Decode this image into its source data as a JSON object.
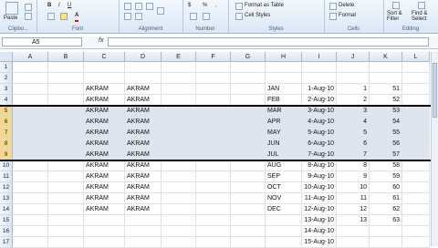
{
  "ribbon": {
    "clipboard": {
      "label": "Clipbo...",
      "paste": "Paste"
    },
    "font": {
      "label": "Font",
      "bold": "B",
      "italic": "I",
      "underline": "U",
      "font_color": "A"
    },
    "alignment": {
      "label": "Alignment"
    },
    "number": {
      "label": "Number",
      "currency": "$",
      "percent": "%",
      "comma": ","
    },
    "styles": {
      "label": "Styles",
      "format_as_table": "Format as Table",
      "cell_styles": "Cell Styles"
    },
    "cells": {
      "label": "Cells",
      "delete": "Delete",
      "format": "Format"
    },
    "editing": {
      "label": "Editing",
      "sort_filter": "Sort & Filter",
      "find_select": "Find & Select"
    }
  },
  "formula_bar": {
    "name_box": "A5",
    "fx": "fx",
    "value": ""
  },
  "columns": [
    "A",
    "B",
    "C",
    "D",
    "E",
    "F",
    "G",
    "H",
    "I",
    "J",
    "K",
    "L"
  ],
  "rows": [
    {
      "n": "1",
      "c": "",
      "d": "",
      "h": "",
      "i": "",
      "j": "",
      "k": "",
      "sel": false
    },
    {
      "n": "2",
      "c": "",
      "d": "",
      "h": "",
      "i": "",
      "j": "",
      "k": "",
      "sel": false
    },
    {
      "n": "3",
      "c": "AKRAM",
      "d": "AKRAM",
      "h": "JAN",
      "i": "1-Aug-10",
      "j": "1",
      "k": "51",
      "sel": false
    },
    {
      "n": "4",
      "c": "AKRAM",
      "d": "AKRAM",
      "h": "FEB",
      "i": "2-Aug-10",
      "j": "2",
      "k": "52",
      "sel": false
    },
    {
      "n": "5",
      "c": "AKRAM",
      "d": "AKRAM",
      "h": "MAR",
      "i": "3-Aug-10",
      "j": "3",
      "k": "53",
      "sel": true
    },
    {
      "n": "6",
      "c": "AKRAM",
      "d": "AKRAM",
      "h": "APR",
      "i": "4-Aug-10",
      "j": "4",
      "k": "54",
      "sel": true
    },
    {
      "n": "7",
      "c": "AKRAM",
      "d": "AKRAM",
      "h": "MAY",
      "i": "5-Aug-10",
      "j": "5",
      "k": "55",
      "sel": true
    },
    {
      "n": "8",
      "c": "AKRAM",
      "d": "AKRAM",
      "h": "JUN",
      "i": "6-Aug-10",
      "j": "6",
      "k": "56",
      "sel": true
    },
    {
      "n": "9",
      "c": "AKRAM",
      "d": "AKRAM",
      "h": "JUL",
      "i": "7-Aug-10",
      "j": "7",
      "k": "57",
      "sel": true
    },
    {
      "n": "10",
      "c": "AKRAM",
      "d": "AKRAM",
      "h": "AUG",
      "i": "8-Aug-10",
      "j": "8",
      "k": "58",
      "sel": false
    },
    {
      "n": "11",
      "c": "AKRAM",
      "d": "AKRAM",
      "h": "SEP",
      "i": "9-Aug-10",
      "j": "9",
      "k": "59",
      "sel": false
    },
    {
      "n": "12",
      "c": "AKRAM",
      "d": "AKRAM",
      "h": "OCT",
      "i": "10-Aug-10",
      "j": "10",
      "k": "60",
      "sel": false
    },
    {
      "n": "13",
      "c": "AKRAM",
      "d": "AKRAM",
      "h": "NOV",
      "i": "11-Aug-10",
      "j": "11",
      "k": "61",
      "sel": false
    },
    {
      "n": "14",
      "c": "AKRAM",
      "d": "AKRAM",
      "h": "DEC",
      "i": "12-Aug-10",
      "j": "12",
      "k": "62",
      "sel": false
    },
    {
      "n": "15",
      "c": "",
      "d": "",
      "h": "",
      "i": "13-Aug-10",
      "j": "13",
      "k": "63",
      "sel": false
    },
    {
      "n": "16",
      "c": "",
      "d": "",
      "h": "",
      "i": "14-Aug-10",
      "j": "",
      "k": "",
      "sel": false
    },
    {
      "n": "17",
      "c": "",
      "d": "",
      "h": "",
      "i": "15-Aug-10",
      "j": "",
      "k": "",
      "sel": false
    }
  ]
}
